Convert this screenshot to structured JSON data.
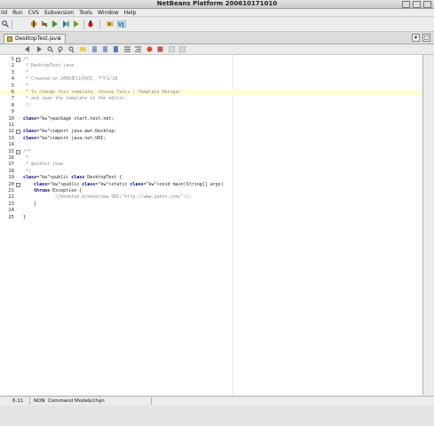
{
  "window": {
    "title": "NetBeans Platform 200610171010"
  },
  "menu": [
    "ild",
    "Run",
    "CVS",
    "Subversion",
    "Tools",
    "Window",
    "Help"
  ],
  "tab": {
    "label": "DesktopTest.java"
  },
  "editor": {
    "lines": [
      {
        "n": "1",
        "t": "/*",
        "k": "cm",
        "fold": "-"
      },
      {
        "n": "2",
        "t": " * DesktopTest.java",
        "k": "cm"
      },
      {
        "n": "3",
        "t": " *",
        "k": "cm"
      },
      {
        "n": "4",
        "t": " * Created on 2006年11月9日, 下午1:18",
        "k": "cm"
      },
      {
        "n": "5",
        "t": " *",
        "k": "cm"
      },
      {
        "n": "6",
        "t": " * To change this template, choose Tools | Template Manager",
        "k": "cm",
        "current": true
      },
      {
        "n": "7",
        "t": " * and open the template in the editor.",
        "k": "cm"
      },
      {
        "n": "8",
        "t": " */",
        "k": "cm"
      },
      {
        "n": "9",
        "t": "",
        "k": ""
      },
      {
        "n": "10",
        "t": "package start.test.net;",
        "k": "pkg"
      },
      {
        "n": "11",
        "t": "",
        "k": ""
      },
      {
        "n": "12",
        "t": "import java.awt.Desktop;",
        "k": "imp",
        "fold": "-"
      },
      {
        "n": "13",
        "t": "import java.net.URI;",
        "k": "imp"
      },
      {
        "n": "14",
        "t": "",
        "k": ""
      },
      {
        "n": "15",
        "t": "/**",
        "k": "cm",
        "fold": "-"
      },
      {
        "n": "16",
        "t": " *",
        "k": "cm"
      },
      {
        "n": "17",
        "t": " * @author jkae",
        "k": "cm"
      },
      {
        "n": "18",
        "t": " */",
        "k": "cm"
      },
      {
        "n": "19",
        "t": "public class DesktopTest {",
        "k": "cls"
      },
      {
        "n": "20",
        "t": "    public static void main(String[] args)",
        "k": "mth",
        "fold": "-"
      },
      {
        "n": "21",
        "t": "    throws Exception {",
        "k": "thr"
      },
      {
        "n": "22",
        "t": "            //Desktop.browse(new URI(\"http://www.yahoo.com/\"));",
        "k": "cm"
      },
      {
        "n": "23",
        "t": "    }",
        "k": ""
      },
      {
        "n": "24",
        "t": "",
        "k": ""
      },
      {
        "n": "25",
        "t": "}",
        "k": ""
      }
    ]
  },
  "status": {
    "position": "6:11",
    "mode": "NON",
    "info": "Command Mode$/chan"
  },
  "icons": {
    "toolbar": [
      "build-icon",
      "clean-build-icon",
      "run-icon",
      "debug-icon",
      "profile-icon"
    ],
    "editor_toolbar": [
      "back-icon",
      "forward-icon",
      "find-icon",
      "find-prev-icon",
      "find-next-icon",
      "toggle-highlight-icon",
      "prev-bookmark-icon",
      "next-bookmark-icon",
      "toggle-bookmark-icon",
      "shift-left-icon",
      "shift-right-icon",
      "start-macro-icon",
      "stop-macro-icon",
      "comment-icon",
      "uncomment-icon"
    ]
  }
}
